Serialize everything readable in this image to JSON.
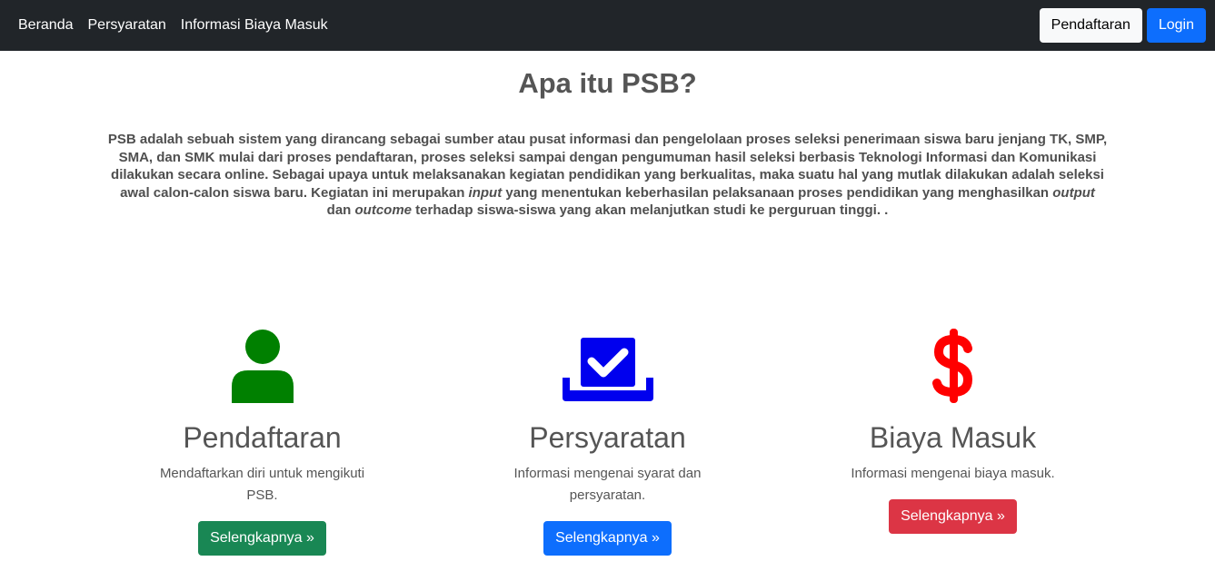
{
  "navbar": {
    "links": [
      "Beranda",
      "Persyaratan",
      "Informasi Biaya Masuk"
    ],
    "register_label": "Pendaftaran",
    "login_label": "Login"
  },
  "page": {
    "title": "Apa itu PSB?",
    "intro": {
      "part1": "PSB adalah sebuah sistem yang dirancang sebagai sumber atau pusat informasi dan pengelolaan proses seleksi penerimaan siswa baru jenjang TK, SMP, SMA, dan SMK mulai dari proses pendaftaran, proses seleksi sampai dengan pengumuman hasil seleksi berbasis Teknologi Informasi dan Komunikasi dilakukan secara online. Sebagai upaya untuk melaksanakan kegiatan pendidikan yang berkualitas, maka suatu hal yang mutlak dilakukan adalah seleksi awal calon-calon siswa baru.  Kegiatan ini merupakan ",
      "em1": "input",
      "part2": " yang menentukan keberhasilan pelaksanaan proses pendidikan yang menghasilkan ",
      "em2": "output",
      "part3": " dan ",
      "em3": "outcome",
      "part4": " terhadap siswa-siswa yang akan melanjutkan studi ke perguruan tinggi.    ."
    }
  },
  "features": [
    {
      "icon": "user-icon",
      "title": "Pendaftaran",
      "desc": "Mendaftarkan diri untuk mengikuti PSB.",
      "button": "Selengkapnya »",
      "color": "#008000"
    },
    {
      "icon": "checkbox-tray-icon",
      "title": "Persyaratan",
      "desc": "Informasi mengenai syarat dan persyaratan.",
      "button": "Selengkapnya »",
      "color": "#0000ee"
    },
    {
      "icon": "dollar-icon",
      "title": "Biaya Masuk",
      "desc": "Informasi mengenai biaya masuk.",
      "button": "Selengkapnya »",
      "color": "#ff0000"
    }
  ]
}
